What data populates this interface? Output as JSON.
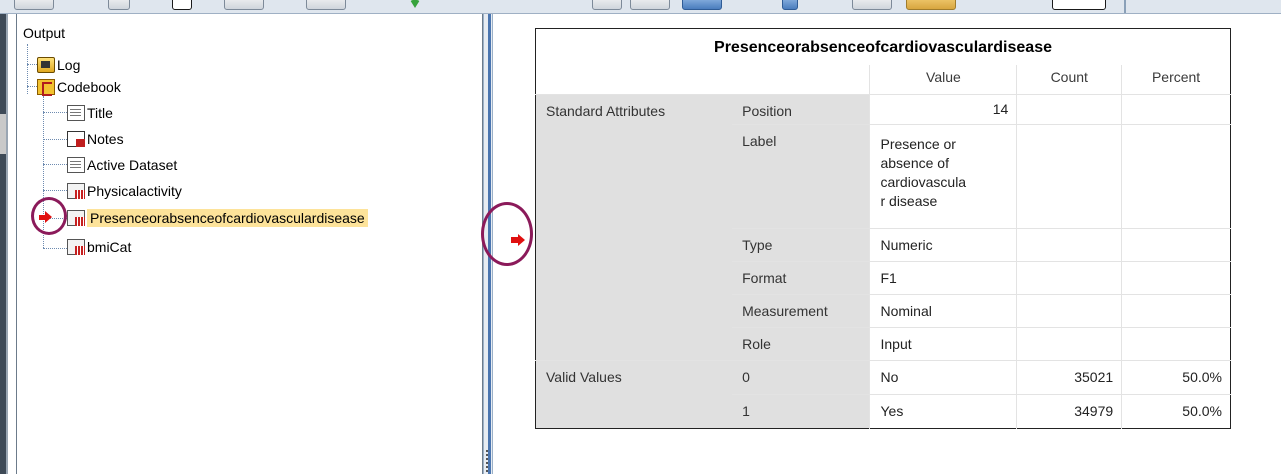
{
  "outline": {
    "root_label": "Output",
    "nodes": [
      {
        "label": "Log"
      },
      {
        "label": "Codebook"
      },
      {
        "label": "Title"
      },
      {
        "label": "Notes"
      },
      {
        "label": "Active Dataset"
      },
      {
        "label": "Physicalactivity"
      },
      {
        "label": "Presenceorabsenceofcardiovasculardisease"
      },
      {
        "label": "bmiCat"
      }
    ]
  },
  "codebook": {
    "title": "Presenceorabsenceofcardiovasculardisease",
    "columns": {
      "value": "Value",
      "count": "Count",
      "percent": "Percent"
    },
    "standard_attributes_label": "Standard Attributes",
    "attributes": [
      {
        "name": "Position",
        "value": "14"
      },
      {
        "name": "Label",
        "value": "Presence or absence of cardiovascular disease",
        "value_lines": [
          "Presence or",
          "absence of",
          "cardiovascula",
          "r disease"
        ]
      },
      {
        "name": "Type",
        "value": "Numeric"
      },
      {
        "name": "Format",
        "value": "F1"
      },
      {
        "name": "Measurement",
        "value": "Nominal"
      },
      {
        "name": "Role",
        "value": "Input"
      }
    ],
    "valid_values_label": "Valid Values",
    "valid_values": [
      {
        "code": "0",
        "label": "No",
        "count": "35021",
        "percent": "50.0%"
      },
      {
        "code": "1",
        "label": "Yes",
        "count": "34979",
        "percent": "50.0%"
      }
    ]
  },
  "colors": {
    "selection_highlight": "#fde39a",
    "annotation_circle": "#8b1a5a",
    "arrow": "#e01010",
    "table_label_fill": "#e0e0e0"
  }
}
